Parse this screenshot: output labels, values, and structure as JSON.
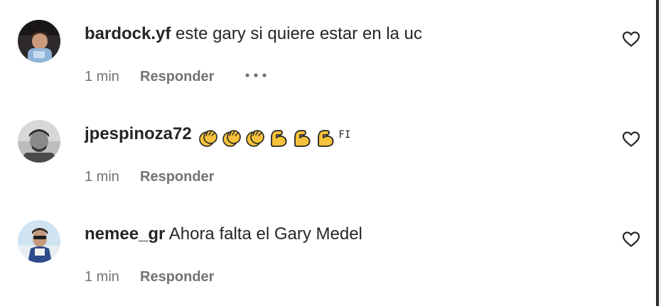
{
  "comments": [
    {
      "username": "bardock.yf",
      "text": "este gary si quiere estar en la uc",
      "time": "1 min",
      "reply_label": "Responder",
      "has_more": true,
      "avatar_icon": "avatar-photo-child"
    },
    {
      "username": "jpespinoza72",
      "text": "",
      "emojis": [
        "clapping-hands",
        "clapping-hands",
        "clapping-hands",
        "flexed-biceps",
        "flexed-biceps",
        "flexed-biceps"
      ],
      "suffix": "FI",
      "time": "1 min",
      "reply_label": "Responder",
      "avatar_icon": "avatar-photo-man"
    },
    {
      "username": "nemee_gr",
      "text": "Ahora falta el Gary Medel",
      "time": "1 min",
      "reply_label": "Responder",
      "avatar_icon": "avatar-photo-sunglasses"
    }
  ],
  "colors": {
    "text": "#262626",
    "meta": "#737373",
    "emoji_yellow": "#F6C13B"
  }
}
